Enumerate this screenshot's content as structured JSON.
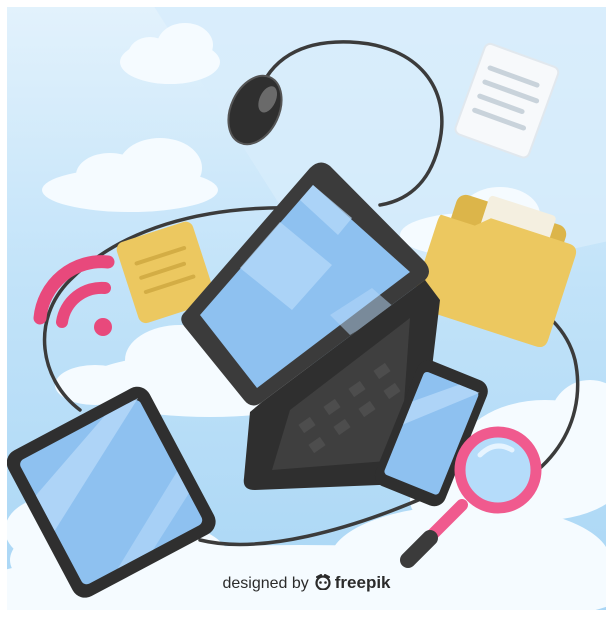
{
  "credit": {
    "prefix": "designed by",
    "brand": "freepik",
    "icon": "freepik-logo-icon"
  },
  "illustration": {
    "icons": [
      "cloud-icon",
      "computer-mouse-icon",
      "document-icon",
      "folder-icon",
      "wifi-icon",
      "laptop-icon",
      "tablet-icon",
      "smartphone-icon",
      "magnifying-glass-icon",
      "cable"
    ],
    "colors": {
      "sky_top": "#e3f2fc",
      "sky_bottom": "#a9d6f5",
      "cloud": "#f5fbff",
      "device_body": "#3b3b3b",
      "screen": "#8ec1f0",
      "screen_stripe": "#b8dafa",
      "folder": "#ecc860",
      "wifi": "#e8497c",
      "magnifier": "#f05a8e"
    }
  }
}
